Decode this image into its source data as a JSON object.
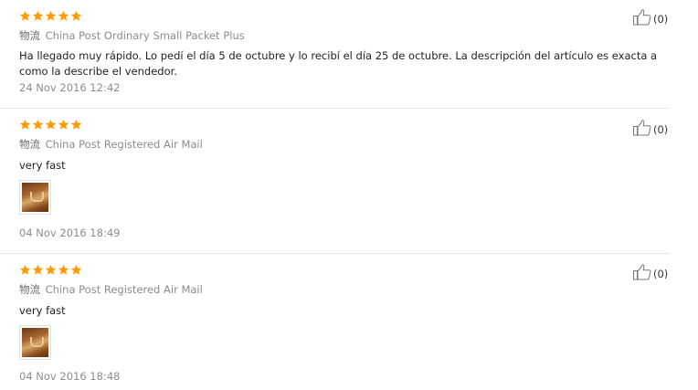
{
  "colors": {
    "star": "#ff9a00",
    "divider": "#e6e6e6",
    "meta_text": "#8c8c8c"
  },
  "reviews": [
    {
      "rating": 5,
      "shipping_label": "物流",
      "shipping_method": "China Post Ordinary Small Packet Plus",
      "text": "Ha llegado muy rápido. Lo pedí el día 5 de octubre y lo recibí el día 25 de octubre. La descripción del artículo es exacta a como la describe el vendedor.",
      "date": "24 Nov 2016 12:42",
      "helpful_count": "(0)",
      "has_photo": false
    },
    {
      "rating": 5,
      "shipping_label": "物流",
      "shipping_method": "China Post Registered Air Mail",
      "text": "very fast",
      "date": "04 Nov 2016 18:49",
      "helpful_count": "(0)",
      "has_photo": true
    },
    {
      "rating": 5,
      "shipping_label": "物流",
      "shipping_method": "China Post Registered Air Mail",
      "text": "very fast",
      "date": "04 Nov 2016 18:48",
      "helpful_count": "(0)",
      "has_photo": true
    }
  ],
  "icons": {
    "star": "star-icon",
    "helpful": "thumbs-up-icon"
  }
}
